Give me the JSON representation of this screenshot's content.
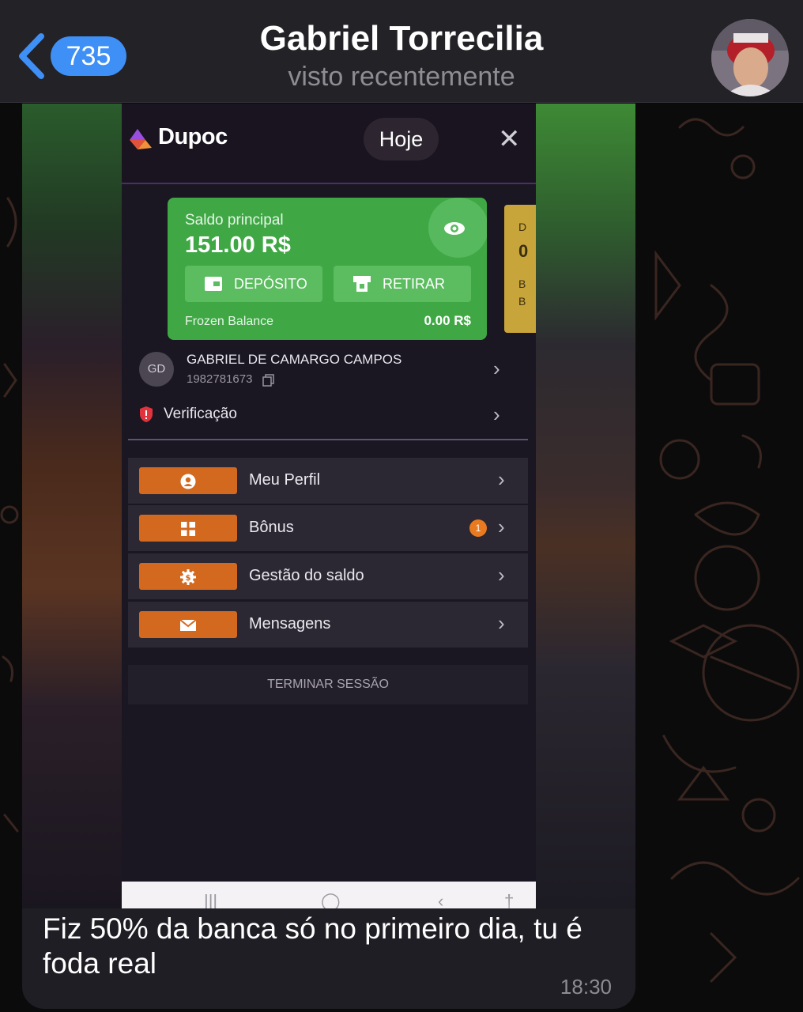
{
  "header": {
    "back_count": "735",
    "title": "Gabriel Torrecilia",
    "status": "visto recentemente"
  },
  "app": {
    "logo": "Dupoc",
    "date_pill": "Hoje",
    "balance": {
      "label": "Saldo principal",
      "amount": "151.00 R$",
      "deposit_label": "DEPÓSITO",
      "withdraw_label": "RETIRAR",
      "frozen_label": "Frozen Balance",
      "frozen_value": "0.00 R$"
    },
    "side_card_letters": [
      "D",
      "0",
      "B",
      "B"
    ],
    "user": {
      "initials": "GD",
      "name": "GABRIEL DE CAMARGO CAMPOS",
      "id": "1982781673"
    },
    "verification_label": "Verificação",
    "menu": [
      {
        "label": "Meu Perfil",
        "icon": "user-icon"
      },
      {
        "label": "Bônus",
        "icon": "gift-icon",
        "badge": "1"
      },
      {
        "label": "Gestão do saldo",
        "icon": "money-gear-icon"
      },
      {
        "label": "Mensagens",
        "icon": "envelope-icon"
      }
    ],
    "logout_label": "TERMINAR SESSÃO"
  },
  "message": {
    "text": "Fiz 50% da banca só no primeiro dia, tu é foda real",
    "time": "18:30"
  },
  "colors": {
    "telegram_accent": "#3e8ff6",
    "card_green": "#3fa845",
    "menu_orange": "#d3681f",
    "bubble": "#1f1e24"
  }
}
